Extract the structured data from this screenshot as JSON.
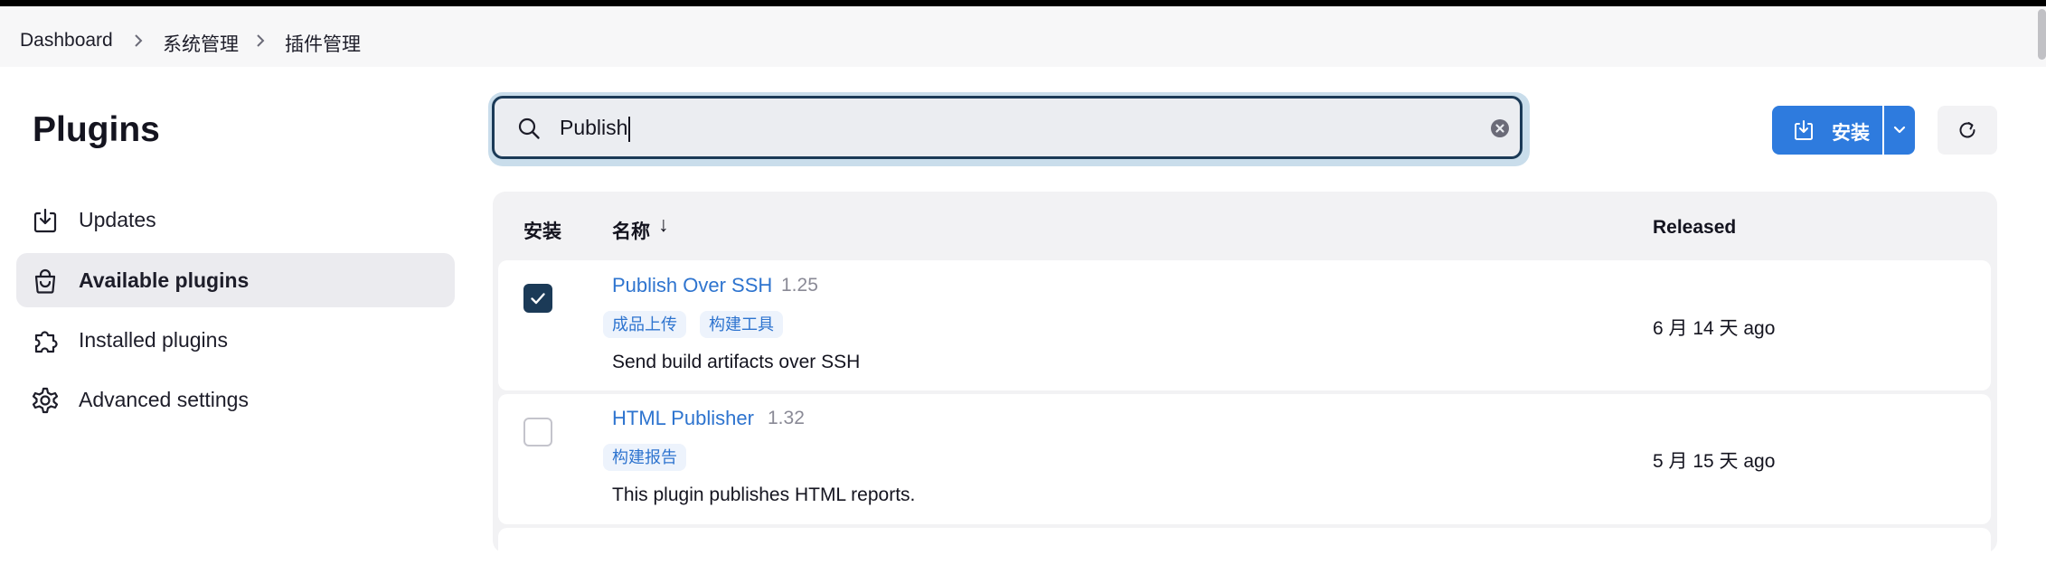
{
  "breadcrumb": [
    "Dashboard",
    "系统管理",
    "插件管理"
  ],
  "page": {
    "title": "Plugins"
  },
  "sidebar": {
    "items": [
      {
        "label": "Updates",
        "icon": "download-icon",
        "active": false
      },
      {
        "label": "Available plugins",
        "icon": "shopping-bag-icon",
        "active": true
      },
      {
        "label": "Installed plugins",
        "icon": "puzzle-icon",
        "active": false
      },
      {
        "label": "Advanced settings",
        "icon": "gear-icon",
        "active": false
      }
    ]
  },
  "search": {
    "value": "Publish",
    "placeholder": ""
  },
  "toolbar": {
    "install_label": "安装"
  },
  "table": {
    "headers": {
      "install": "安装",
      "name": "名称",
      "sort_indicator": "↓",
      "released": "Released"
    },
    "rows": [
      {
        "checked": true,
        "name": "Publish Over SSH",
        "version": "1.25",
        "tags": [
          "成品上传",
          "构建工具"
        ],
        "description": "Send build artifacts over SSH",
        "released": "6 月 14 天 ago"
      },
      {
        "checked": false,
        "name": "HTML Publisher",
        "version": "1.32",
        "tags": [
          "构建报告"
        ],
        "description": "This plugin publishes HTML reports.",
        "released": "5 月 15 天 ago"
      }
    ]
  },
  "colors": {
    "accent": "#2e7bde",
    "link": "#2e74cf",
    "checkbox_checked": "#1b3a57",
    "search_border": "#1b3a57"
  }
}
